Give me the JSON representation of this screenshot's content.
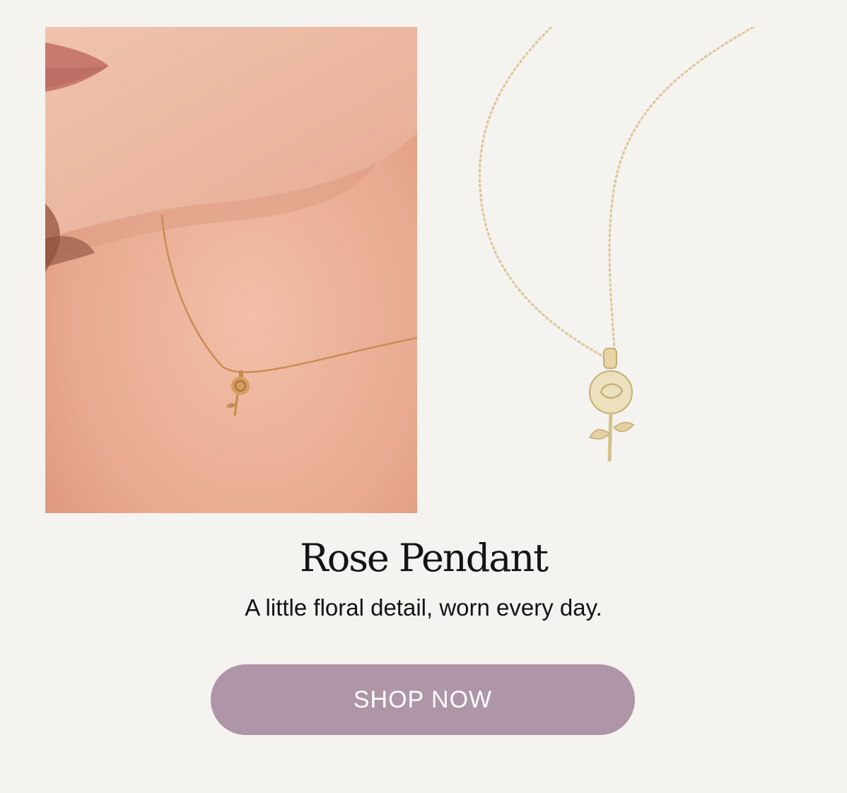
{
  "product": {
    "title": "Rose Pendant",
    "tagline": "A little floral detail, worn every day."
  },
  "cta": {
    "label": "SHOP NOW"
  },
  "images": {
    "model_photo": "model-wearing-rose-pendant-image",
    "product_photo": "rose-pendant-necklace-image"
  },
  "colors": {
    "background": "#f5f3ef",
    "button_bg": "#ae95a8",
    "button_text": "#ffffff",
    "gold": "#d8c08a"
  }
}
